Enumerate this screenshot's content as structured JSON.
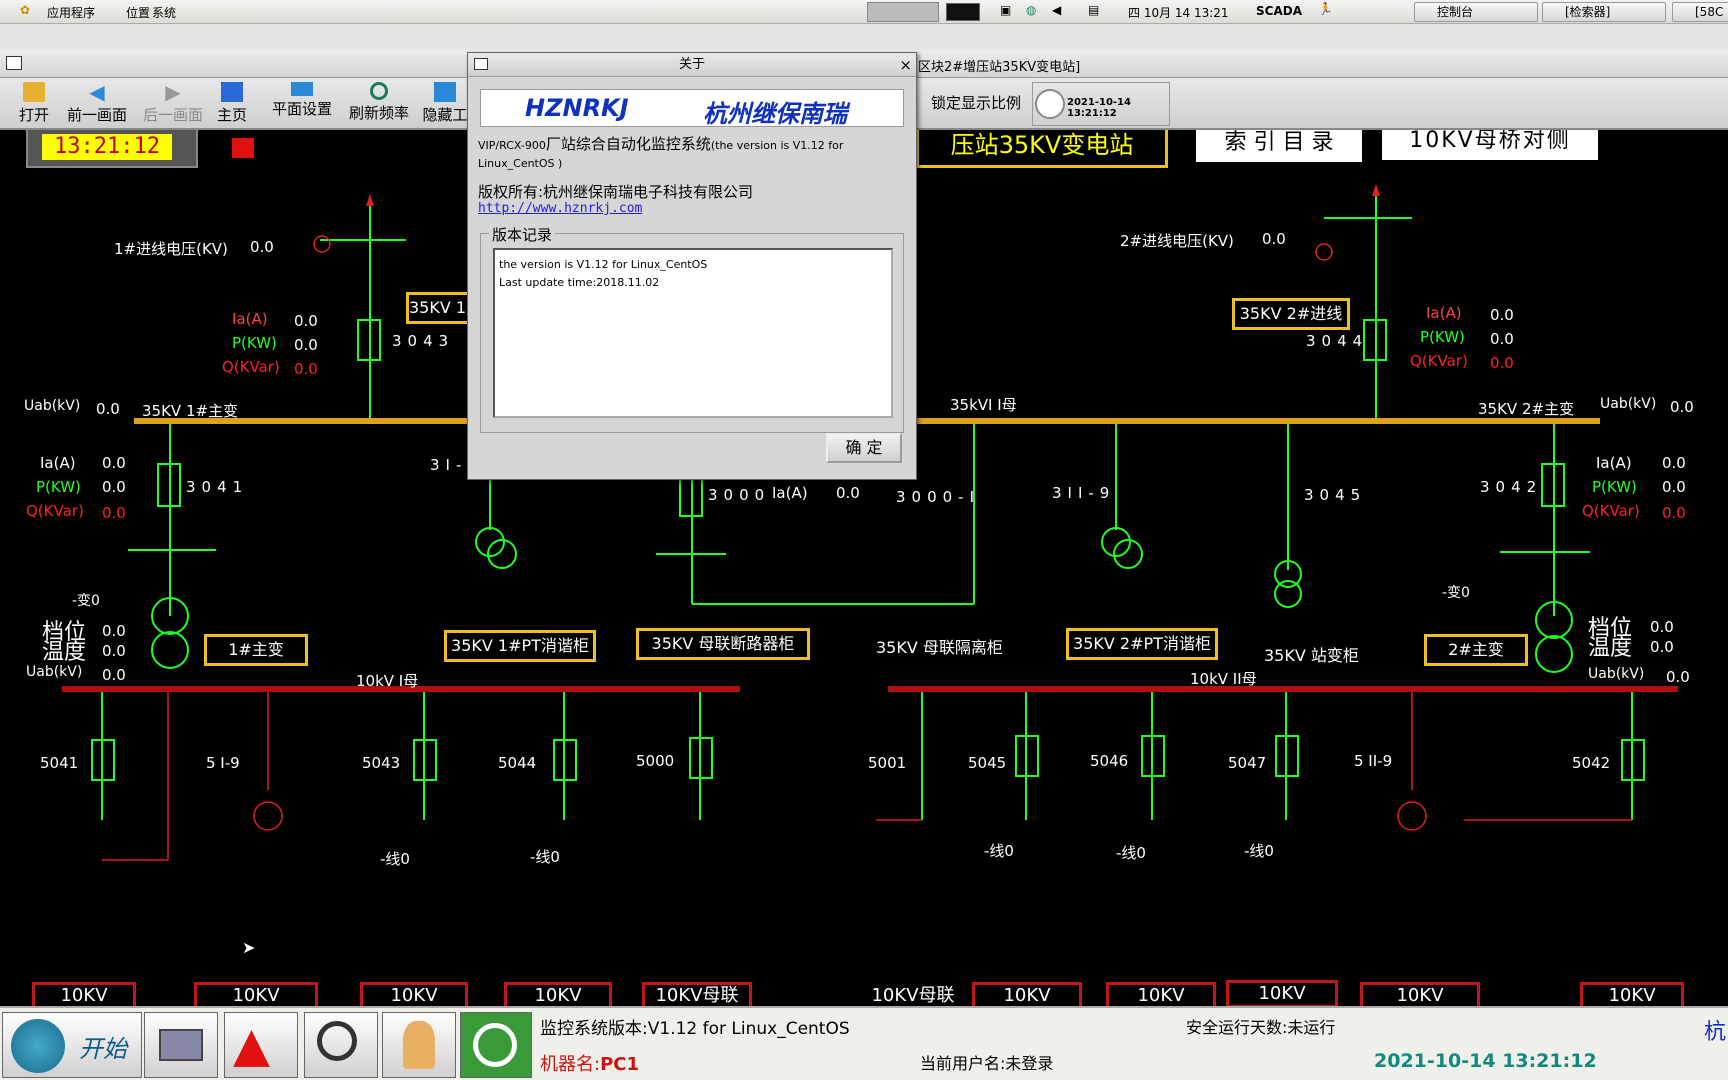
{
  "top_panel": {
    "menu": [
      "应用程序",
      "位置",
      "系统"
    ],
    "clock": "四 10月 14 13:21",
    "app_label": "SCADA",
    "tasks": [
      "控制台",
      "[检索器]",
      "[58C"
    ]
  },
  "window": {
    "title": "区块2#增压站35KV变电站]",
    "toolbar": [
      "打开",
      "前一画面",
      "后一画面",
      "主页",
      "平面设置",
      "刷新频率",
      "隐藏工"
    ],
    "lock_label": "锁定显示比例",
    "clock_text": "2021-10-14 13:21:12"
  },
  "dialog": {
    "title": "关于",
    "close": "×",
    "brand_en": "HZNRKJ",
    "brand_cn": "杭州继保南瑞",
    "system_line1_a": "VIP/RCX-900",
    "system_line1_b": "厂站综合自动化监控系统",
    "system_line1_c": "(the version is V1.12 for",
    "system_line2": "Linux_CentOS )",
    "copyright": "版权所有:杭州继保南瑞电子科技有限公司",
    "url": "http://www.hznrkj.com",
    "group_title": "版本记录",
    "log": [
      "the version is V1.12 for Linux_CentOS",
      "Last update time:2018.11.02"
    ],
    "ok": "确 定"
  },
  "scada": {
    "digital_clock": "13:21:12",
    "station_title": "压站35KV变电站",
    "index_button": "索 引 目 录",
    "opposite_button": "10KV母桥对侧",
    "v1_label": "1#进线电压(KV)",
    "v1_value": "0.0",
    "v2_label": "2#进线电压(KV)",
    "v2_value": "0.0",
    "line1_box": "35KV 1#",
    "line2_box": "35KV 2#进线",
    "ia": "Ia(A)",
    "p": "P(KW)",
    "q": "Q(KVar)",
    "uab": "Uab(kV)",
    "zero": "0.0",
    "bus35_1": "35KV   1#主变",
    "bus35_2": "35KV   2#主变",
    "bus35_mid": "35kVI I母",
    "sw": [
      "3043",
      "3044",
      "3041",
      "3042",
      "3I-9",
      "3000",
      "3000-I",
      "3II-9",
      "3045"
    ],
    "ia_3000": "Ia(A)",
    "ia_3000_val": "0.0",
    "tap1": "-变0",
    "tap2": "-变0",
    "dangwei": "档位",
    "wendu": "温度",
    "yboxes": [
      "1#主变",
      "35KV 1#PT消谐柜",
      "35KV 母联断路器柜",
      "35KV 2#PT消谐柜",
      "2#主变"
    ],
    "cab_tie_iso": "35KV 母联隔离柜",
    "cab_station": "35KV 站变柜",
    "bus10_1": "10kV I母",
    "bus10_2": "10kV II母",
    "feeders": [
      "5041",
      "5 I-9",
      "5043",
      "5044",
      "5000",
      "5001",
      "5045",
      "5046",
      "5047",
      "5 II-9",
      "5042"
    ],
    "line0": "-线0",
    "bottom_boxes": [
      "10KV",
      "10KV",
      "10KV",
      "10KV",
      "10KV母联",
      "10KV母联",
      "10KV",
      "10KV",
      "10KV",
      "10KV",
      "10KV"
    ]
  },
  "taskbar": {
    "start": "开始",
    "version": "监控系统版本:V1.12 for Linux_CentOS",
    "safe_days": "安全运行天数:未运行",
    "machine_label": "机器名:",
    "machine_name": "PC1",
    "user": "当前用户名:未登录",
    "datetime": "2021-10-14 13:21:12",
    "edge": "杭"
  }
}
